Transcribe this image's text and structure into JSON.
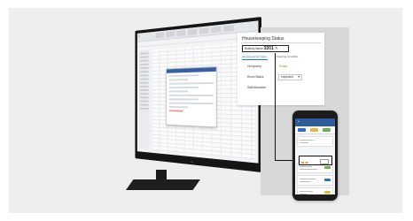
{
  "housekeeping": {
    "title": "Housekeeping Status",
    "building_label": "Building Name",
    "room_number": "3201",
    "tabs": [
      "Housekeeping Status",
      "Cleaning Checklist"
    ],
    "rows": [
      {
        "label": "Occupancy",
        "value": "Empty"
      },
      {
        "label": "Room Status",
        "value": "Inspected"
      },
      {
        "label": "Staff Allocation",
        "value": ""
      }
    ]
  },
  "colors": {
    "accent_blue": "#2c6fc9",
    "status_green": "#6a9a2a",
    "phone_header": "#2f5b9a"
  }
}
